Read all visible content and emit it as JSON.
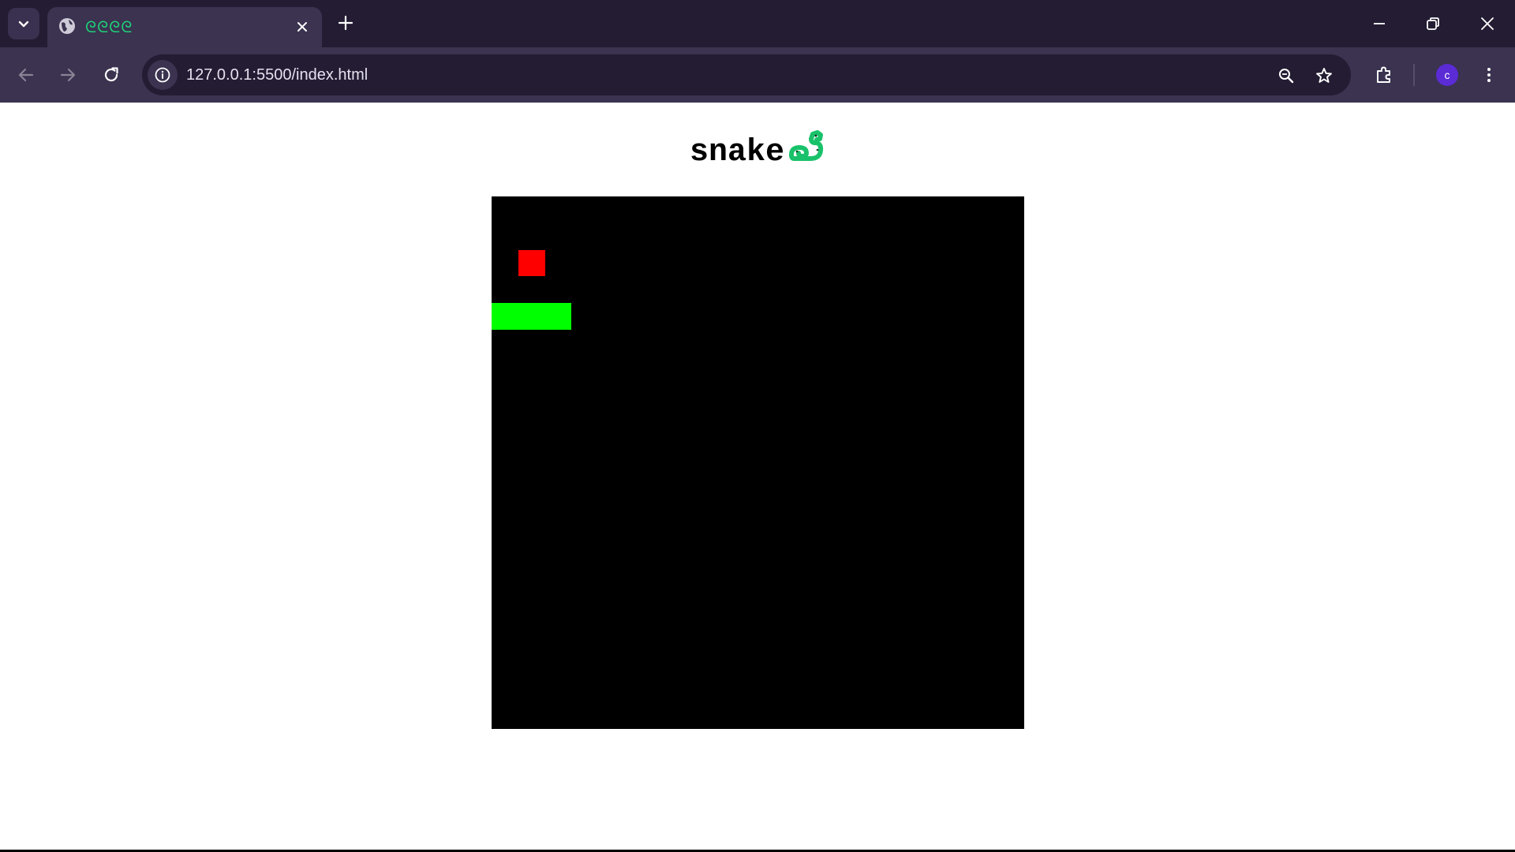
{
  "browser": {
    "tab": {
      "title": "ᘓᘓᘓᘓ",
      "favicon": "globe-icon"
    },
    "address": {
      "url": "127.0.0.1:5500/index.html"
    },
    "profile": {
      "initial": "c",
      "color": "#5b2bd6"
    },
    "colors": {
      "frame": "#231c33",
      "toolbar": "#3b3350",
      "tab_title": "#1fd27a"
    }
  },
  "page": {
    "title": "snake",
    "title_logo": "snake-logo-icon"
  },
  "game": {
    "grid_size": 20,
    "food": {
      "col": 1,
      "row": 2,
      "color": "#ff0000"
    },
    "snake": {
      "color": "#00ff00",
      "segments": [
        {
          "col": 0,
          "row": 4
        },
        {
          "col": 1,
          "row": 4
        },
        {
          "col": 2,
          "row": 4
        }
      ]
    },
    "background": "#000000"
  }
}
